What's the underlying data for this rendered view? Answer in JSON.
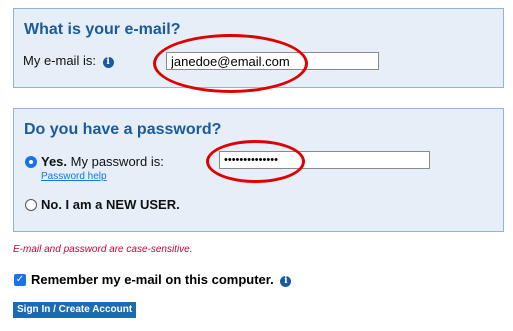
{
  "email_section": {
    "title": "What is your e-mail?",
    "label": "My e-mail is:",
    "info_icon": "info-icon",
    "email_value": "janedoe@email.com"
  },
  "password_section": {
    "title": "Do you have a password?",
    "yes_bold": "Yes.",
    "yes_rest": "My password is:",
    "password_value": "••••••••••••••",
    "password_help": "Password help",
    "new_user": "No. I am a NEW USER."
  },
  "case_note": "E-mail and password are case-sensitive.",
  "remember": {
    "label": "Remember my e-mail on this computer.",
    "checked": true,
    "info_icon": "info-icon"
  },
  "signin_button": "Sign In / Create Account",
  "colors": {
    "panel_bg": "#e6eef7",
    "heading": "#1d5a9c",
    "annotation_red": "#e00000",
    "accent_blue": "#1a73e8",
    "note_red": "#d0003a"
  }
}
